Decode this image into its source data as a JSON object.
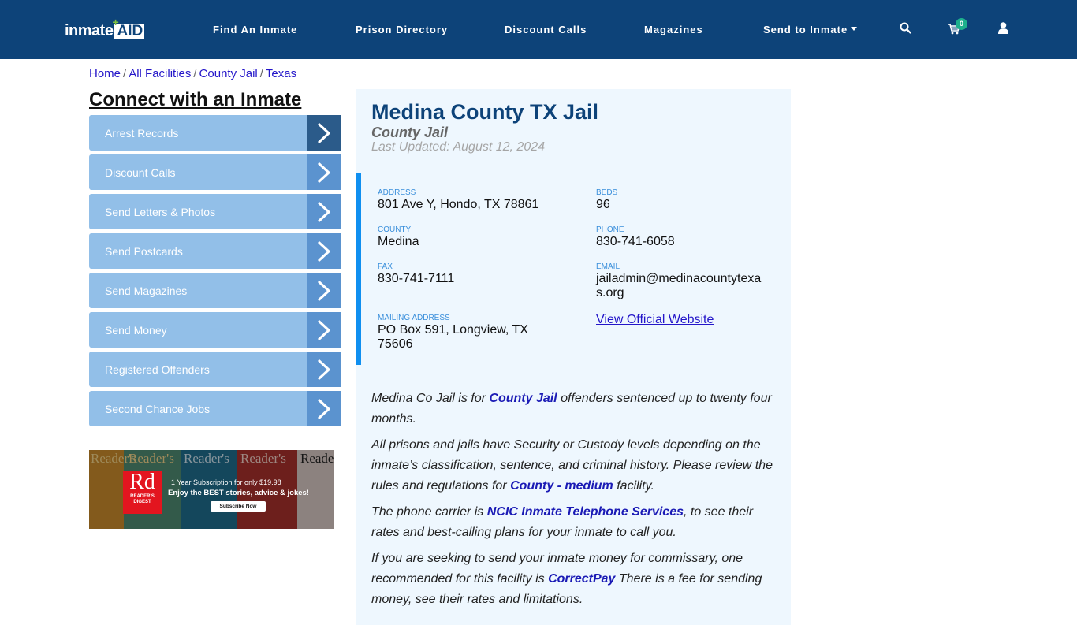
{
  "header": {
    "logo": {
      "part1": "inmate",
      "part2": "AID",
      "plus": "+"
    },
    "nav": [
      {
        "label": "Find An Inmate"
      },
      {
        "label": "Prison Directory"
      },
      {
        "label": "Discount Calls"
      },
      {
        "label": "Magazines"
      },
      {
        "label": "Send to Inmate",
        "has_dropdown": true
      }
    ],
    "icons": [
      "search-icon",
      "cart-icon",
      "user-icon"
    ],
    "cart_count": "0"
  },
  "breadcrumb": [
    {
      "label": "Home"
    },
    {
      "label": "All Facilities"
    },
    {
      "label": "County Jail"
    },
    {
      "label": "Texas"
    }
  ],
  "breadcrumb_separator": "/",
  "sidebar": {
    "title": "Connect with an Inmate",
    "items": [
      {
        "label": "Arrest Records",
        "active": true
      },
      {
        "label": "Discount Calls"
      },
      {
        "label": "Send Letters & Photos"
      },
      {
        "label": "Send Postcards"
      },
      {
        "label": "Send Magazines"
      },
      {
        "label": "Send Money"
      },
      {
        "label": "Registered Offenders"
      },
      {
        "label": "Second Chance Jobs"
      }
    ],
    "ad": {
      "brand_big": "Rd",
      "brand_small_1": "READER'S",
      "brand_small_2": "DIGEST",
      "line1": "1 Year Subscription for only $19.98",
      "line2": "Enjoy the BEST stories, advice & jokes!",
      "button": "Subscribe Now",
      "masthead": "Reader's"
    }
  },
  "facility": {
    "name": "Medina County TX Jail",
    "type": "County Jail",
    "last_updated": "Last Updated: August 12, 2024",
    "fields": {
      "address": {
        "label": "ADDRESS",
        "value": "801 Ave Y, Hondo, TX 78861"
      },
      "beds": {
        "label": "BEDS",
        "value": "96"
      },
      "county": {
        "label": "COUNTY",
        "value": "Medina"
      },
      "phone": {
        "label": "PHONE",
        "value": "830-741-6058"
      },
      "fax": {
        "label": "FAX",
        "value": "830-741-7111"
      },
      "email": {
        "label": "EMAIL",
        "value_line1": "jailadmin@medinacountytexa",
        "value_line2": "s.org"
      },
      "mailing": {
        "label": "MAILING ADDRESS",
        "value_line1": "PO Box 591, Longview, TX",
        "value_line2": "75606"
      },
      "website_link": "View Official Website"
    },
    "paragraphs": {
      "p1": {
        "a": "Medina Co Jail is for ",
        "link": "County Jail",
        "b": " offenders sentenced up to twenty four months."
      },
      "p2": {
        "a": "All prisons and jails have Security or Custody levels depending on the inmate’s classification, sentence, and criminal history. Please review the rules and regulations for ",
        "link": "County - medium",
        "b": " facility."
      },
      "p3": {
        "a": "The phone carrier is ",
        "link": "NCIC Inmate Telephone Services",
        "b": ", to see their rates and best-calling plans for your inmate to call you."
      },
      "p4": {
        "a": "If you are seeking to send your inmate money for commissary, one recommended for this facility is ",
        "link": "CorrectPay",
        "b": " There is a fee for sending money, see their rates and limitations."
      }
    }
  },
  "colors": {
    "header_bg": "#0d4379",
    "sidebar_item": "#92bfe8",
    "sidebar_arrow": "#5b93cf",
    "sidebar_arrow_active": "#2b5b8a",
    "card_bg": "#eef7fe",
    "accent": "#0f8ff0",
    "badge": "#1db08c"
  }
}
